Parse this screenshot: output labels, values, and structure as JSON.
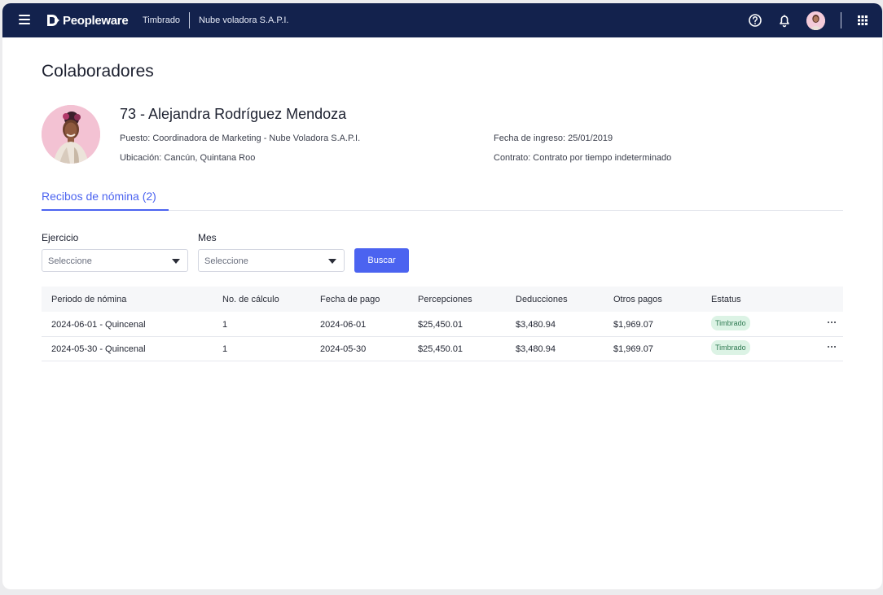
{
  "topbar": {
    "brand": "Peopleware",
    "breadcrumb": [
      "Timbrado",
      "Nube voladora S.A.P.I."
    ],
    "icons": [
      "menu-icon",
      "help-icon",
      "bell-icon",
      "avatar",
      "apps-grid-icon"
    ],
    "color": "#13224d"
  },
  "page": {
    "title": "Colaboradores"
  },
  "employee": {
    "name": "73 - Alejandra Rodríguez Mendoza",
    "puesto": "Puesto: Coordinadora de Marketing - Nube Voladora S.A.P.I.",
    "ubicacion": "Ubicación: Cancún, Quintana Roo",
    "fecha_ingreso": "Fecha de ingreso: 25/01/2019",
    "contrato": "Contrato: Contrato por tiempo indeterminado"
  },
  "tabs": [
    {
      "label": "Recibos de nómina (2)",
      "active": true
    }
  ],
  "filters": {
    "ejercicio": {
      "label": "Ejercicio",
      "placeholder": "Seleccione"
    },
    "mes": {
      "label": "Mes",
      "placeholder": "Seleccione"
    },
    "search_button": "Buscar"
  },
  "table": {
    "columns": [
      "Periodo de nómina",
      "No. de cálculo",
      "Fecha de pago",
      "Percepciones",
      "Deducciones",
      "Otros pagos",
      "Estatus"
    ],
    "rows": [
      {
        "periodo": "2024-06-01 - Quincenal",
        "calculo": "1",
        "fecha": "2024-06-01",
        "percepciones": "$25,450.01",
        "deducciones": "$3,480.94",
        "otros": "$1,969.07",
        "estatus": "Timbrado"
      },
      {
        "periodo": "2024-05-30 - Quincenal",
        "calculo": "1",
        "fecha": "2024-05-30",
        "percepciones": "$25,450.01",
        "deducciones": "$3,480.94",
        "otros": "$1,969.07",
        "estatus": "Timbrado"
      }
    ]
  },
  "colors": {
    "accent": "#4b63f0",
    "status_bg": "#dcf3e5",
    "status_text": "#2f7a52"
  }
}
